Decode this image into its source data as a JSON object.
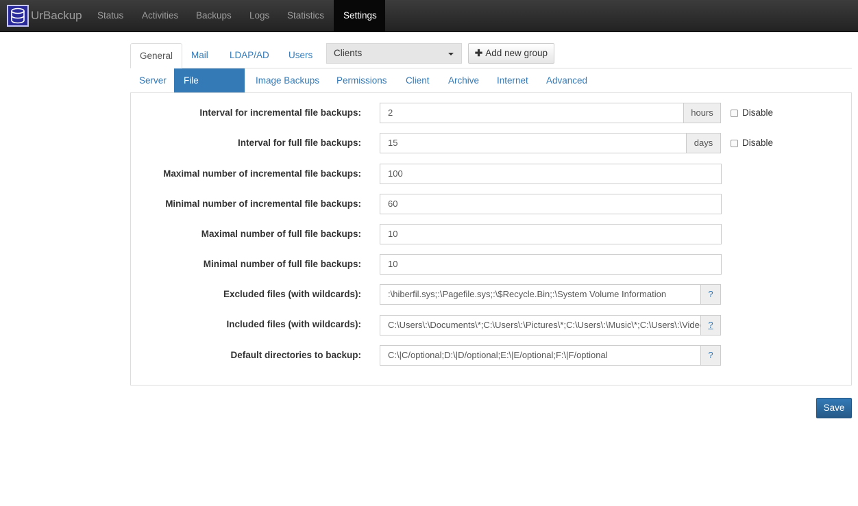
{
  "navbar": {
    "brand": "UrBackup",
    "items": [
      "Status",
      "Activities",
      "Backups",
      "Logs",
      "Statistics",
      "Settings"
    ],
    "active": "Settings"
  },
  "top_tabs": [
    "General",
    "Mail",
    "LDAP/AD",
    "Users"
  ],
  "client_select": {
    "value": "Clients"
  },
  "add_group_button": "Add new group",
  "sub_tabs": [
    "Server",
    "File Backups",
    "Image Backups",
    "Permissions",
    "Client",
    "Archive",
    "Internet",
    "Advanced"
  ],
  "form": {
    "incr_interval": {
      "label": "Interval for incremental file backups:",
      "value": "2",
      "unit": "hours",
      "disable_label": "Disable"
    },
    "full_interval": {
      "label": "Interval for full file backups:",
      "value": "15",
      "unit": "days",
      "disable_label": "Disable"
    },
    "max_incr": {
      "label": "Maximal number of incremental file backups:",
      "value": "100"
    },
    "min_incr": {
      "label": "Minimal number of incremental file backups:",
      "value": "60"
    },
    "max_full": {
      "label": "Maximal number of full file backups:",
      "value": "10"
    },
    "min_full": {
      "label": "Minimal number of full file backups:",
      "value": "10"
    },
    "excluded": {
      "label": "Excluded files (with wildcards):",
      "value": ":\\hiberfil.sys;:\\Pagefile.sys;:\\$Recycle.Bin;:\\System Volume Information",
      "help": "?"
    },
    "included": {
      "label": "Included files (with wildcards):",
      "value": "C:\\Users\\:\\Documents\\*;C:\\Users\\:\\Pictures\\*;C:\\Users\\:\\Music\\*;C:\\Users\\:\\Videos\\*",
      "help": "?"
    },
    "default_dirs": {
      "label": "Default directories to backup:",
      "value": "C:\\|C/optional;D:\\|D/optional;E:\\|E/optional;F:\\|F/optional",
      "help": "?"
    }
  },
  "save_button": "Save"
}
